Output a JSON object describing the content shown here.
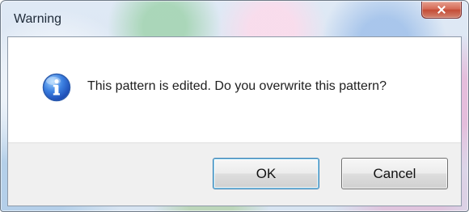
{
  "dialog": {
    "title": "Warning",
    "message": "This pattern is edited. Do you overwrite this pattern?",
    "icon": "info-icon",
    "buttons": {
      "ok": "OK",
      "cancel": "Cancel"
    }
  },
  "colors": {
    "title_text": "#1e2a38",
    "close_button": "#d56b57",
    "default_button_border": "#3c7fb1",
    "button_area": "#f0f0f0",
    "content_area": "#ffffff"
  }
}
